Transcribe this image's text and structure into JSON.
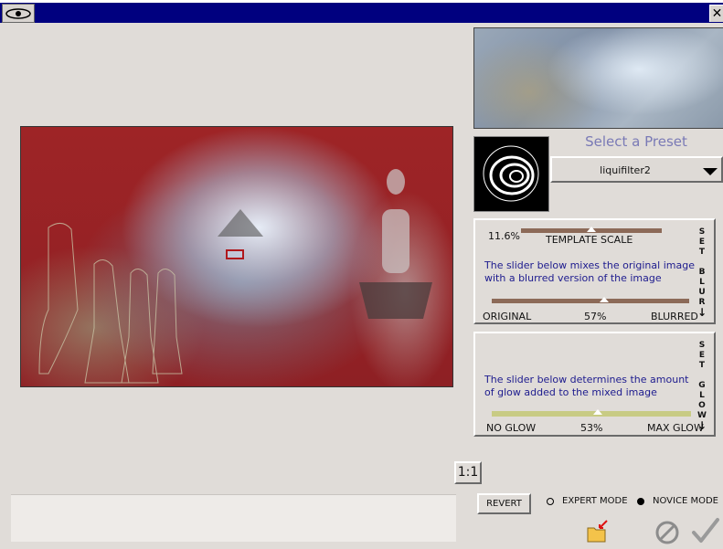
{
  "window": {
    "close_glyph": "✕"
  },
  "preset": {
    "label": "Select a Preset",
    "selected": "liquifilter2"
  },
  "blur_panel": {
    "scale_value": "11.6%",
    "scale_label": "TEMPLATE SCALE",
    "scale_fraction": 0.5,
    "description_line1": "The slider below mixes the original image",
    "description_line2": "with a blurred version of the image",
    "mix_fraction": 0.57,
    "left_label": "ORIGINAL",
    "value": "57%",
    "right_label": "BLURRED",
    "side_button": [
      "S",
      "E",
      "T",
      "",
      "B",
      "L",
      "U",
      "R"
    ],
    "side_arrow": "↓"
  },
  "glow_panel": {
    "description_line1": "The slider below determines the amount",
    "description_line2": "of glow added to the mixed image",
    "glow_fraction": 0.53,
    "left_label": "NO GLOW",
    "value": "53%",
    "right_label": "MAX GLOW",
    "side_button": [
      "S",
      "E",
      "T",
      "",
      "G",
      "L",
      "O",
      "W"
    ],
    "side_arrow": "↓"
  },
  "controls": {
    "zoom_button": "1:1",
    "revert_button": "REVERT",
    "expert_mode": "EXPERT MODE",
    "novice_mode": "NOVICE MODE",
    "selected_mode": "novice"
  },
  "colors": {
    "titlebar": "#00007f",
    "blur_track": "#8c6a58",
    "glow_track": "#c8cb84",
    "preset_label": "#7a7ab6"
  }
}
